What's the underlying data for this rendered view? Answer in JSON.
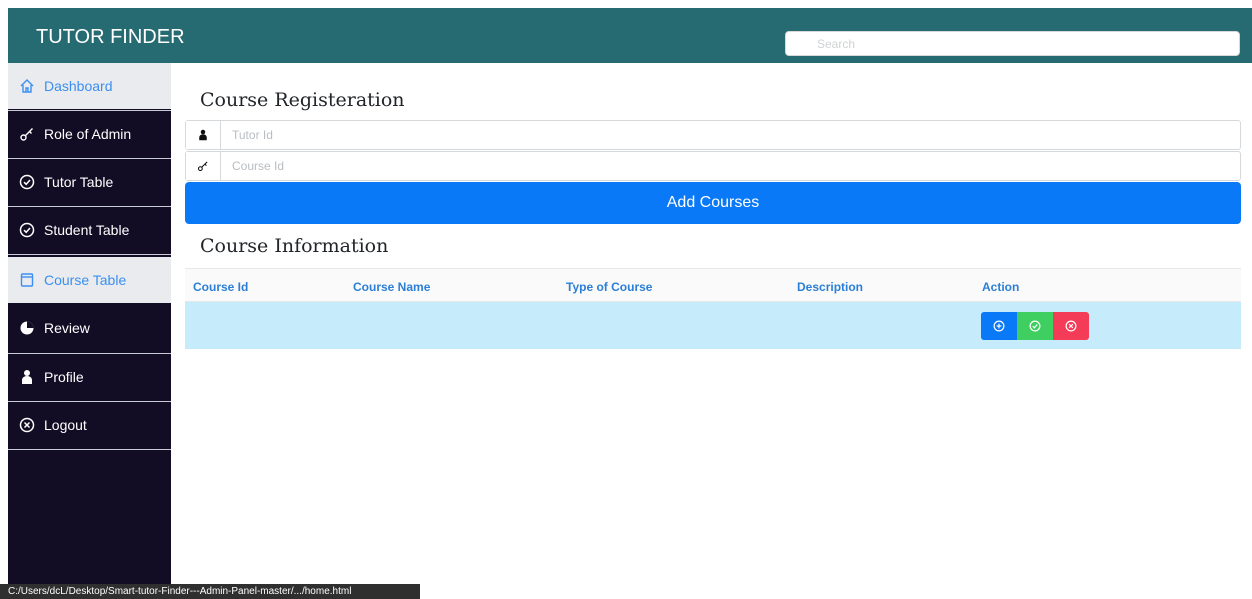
{
  "header": {
    "brand": "TUTOR FINDER",
    "search_placeholder": "Search",
    "color": "#276b72"
  },
  "sidebar": {
    "items": [
      {
        "label": "Dashboard",
        "icon": "home-icon",
        "active": true
      },
      {
        "label": "Role of Admin",
        "icon": "key-icon",
        "active": false
      },
      {
        "label": "Tutor Table",
        "icon": "check-circle-icon",
        "active": false
      },
      {
        "label": "Student Table",
        "icon": "check-circle-icon",
        "active": false
      },
      {
        "label": "Course Table",
        "icon": "book-icon",
        "active": true
      },
      {
        "label": "Review",
        "icon": "pie-chart-icon",
        "active": false
      },
      {
        "label": "Profile",
        "icon": "user-icon",
        "active": false
      },
      {
        "label": "Logout",
        "icon": "close-circle-icon",
        "active": false
      }
    ]
  },
  "registration": {
    "title": "Course Registeration",
    "tutor_id_placeholder": "Tutor Id",
    "course_id_placeholder": "Course Id",
    "add_button": "Add Courses"
  },
  "info": {
    "title": "Course Information",
    "columns": [
      "Course Id",
      "Course Name",
      "Type of Course",
      "Description",
      "Action"
    ],
    "rows": [
      {
        "course_id": "",
        "course_name": "",
        "type": "",
        "description": "",
        "actions": [
          "add-circle-icon",
          "check-circle-icon",
          "close-circle-icon"
        ]
      }
    ]
  },
  "statusbar": {
    "text": "C:/Users/dcL/Desktop/Smart-tutor-Finder---Admin-Panel-master/.../home.html"
  },
  "colors": {
    "primary": "#0a79f7",
    "success": "#3fcf61",
    "danger": "#f43b57",
    "sidebar": "#120d24",
    "row_highlight": "#c6ecfb"
  }
}
